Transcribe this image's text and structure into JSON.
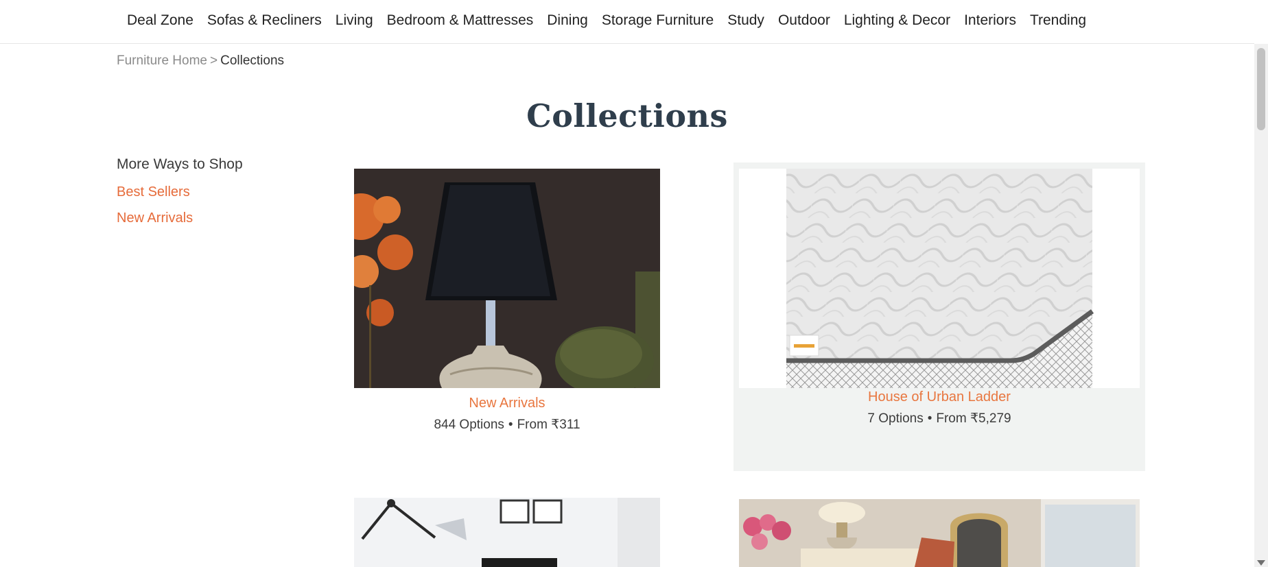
{
  "nav": {
    "items": [
      "Deal Zone",
      "Sofas & Recliners",
      "Living",
      "Bedroom & Mattresses",
      "Dining",
      "Storage Furniture",
      "Study",
      "Outdoor",
      "Lighting & Decor",
      "Interiors",
      "Trending"
    ]
  },
  "breadcrumb": {
    "home": "Furniture Home",
    "separator": ">",
    "current": "Collections"
  },
  "page": {
    "title": "Collections"
  },
  "sidebar": {
    "heading": "More Ways to Shop",
    "links": [
      "Best Sellers",
      "New Arrivals"
    ]
  },
  "cards": [
    {
      "name": "New Arrivals",
      "options": "844 Options",
      "price": "From ₹311"
    },
    {
      "name": "House of Urban Ladder",
      "options": "7 Options",
      "price": "From ₹5,279"
    }
  ],
  "colors": {
    "accent": "#e8763f",
    "title": "#2f3e4c",
    "card_highlight": "#f1f3f2"
  }
}
